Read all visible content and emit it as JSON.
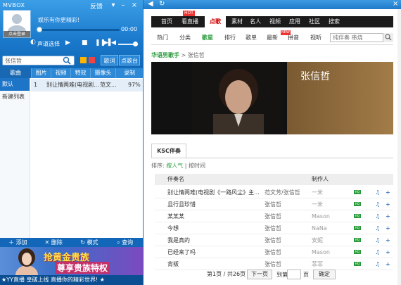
{
  "player": {
    "title": "MVBOX",
    "feedback": "反馈",
    "avatar_caption": "点击登录",
    "now_playing": "娱乐有你更精彩!",
    "time": "00:00",
    "sound_select": "声道选择",
    "search_placeholder": "张信哲",
    "lyric_btn": "歌词",
    "vod_btn": "点歌台",
    "tabs": [
      "歌曲",
      "图片",
      "视频",
      "特效",
      "摄像头",
      "录制"
    ],
    "sidebar": [
      "默认",
      "新建列表"
    ],
    "song": {
      "index": "1",
      "title": "别让情两难(电视剧...",
      "artist": "范文...",
      "progress": "97%"
    },
    "bottom": [
      "添加",
      "删除",
      "模式",
      "查询"
    ],
    "ad_line1": "抢黄金贵族",
    "ad_line2": "尊享贵族特权",
    "ticker": "★YY直播  皇磋上线  直播你的精彩世界! ★"
  },
  "browser": {
    "nav1": [
      "首页",
      "看直播",
      "点歌",
      "素材",
      "名人",
      "视频",
      "应用",
      "社区",
      "搜索"
    ],
    "hot": "HOT",
    "nav2": [
      "热门",
      "分类",
      "歌星",
      "排行",
      "歌单",
      "最新",
      "拼音",
      "视听"
    ],
    "new": "NEW",
    "search_placeholder": "纯伴奏 串烧",
    "breadcrumb": {
      "cat": "华语男歌手",
      "sep": ">",
      "name": "张信哲"
    },
    "banner_name": "张信哲",
    "tab": "KSC伴奏",
    "sort": {
      "label": "排序:",
      "a": "按人气",
      "sep": "|",
      "b": "按时间"
    },
    "headers": {
      "name": "伴奏名",
      "maker": "制作人"
    },
    "rows": [
      {
        "name": "别让情两难(电视剧《一路风尘》主...",
        "singer": "范文芳/张信哲",
        "maker": "一米"
      },
      {
        "name": "且行且珍惜",
        "singer": "张信哲",
        "maker": "一米"
      },
      {
        "name": "某某某",
        "singer": "张信哲",
        "maker": "Mason"
      },
      {
        "name": "今想",
        "singer": "张信哲",
        "maker": "NaNa"
      },
      {
        "name": "我是真的",
        "singer": "张信哲",
        "maker": "安妮"
      },
      {
        "name": "已经来了吗",
        "singer": "张信哲",
        "maker": "Mason"
      },
      {
        "name": "背叛",
        "singer": "张信哲",
        "maker": "菲菲"
      }
    ],
    "hq": "HQ",
    "pager": {
      "info": "第1页 / 共26页",
      "next": "下一页",
      "goto": "到第",
      "page": "页",
      "confirm": "确定"
    }
  }
}
